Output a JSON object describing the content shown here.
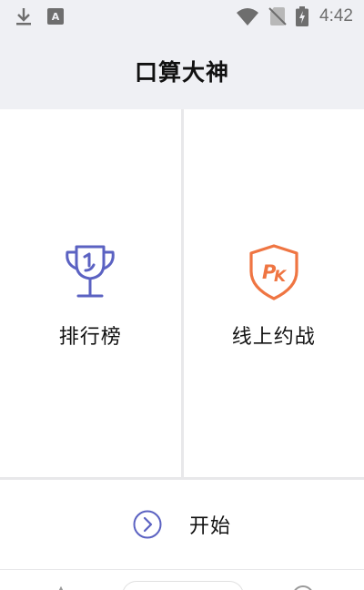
{
  "status_bar": {
    "time": "4:42",
    "icons": [
      "download-icon",
      "keyboard-a-icon",
      "wifi-icon",
      "no-sim-icon",
      "battery-charging-icon"
    ]
  },
  "header": {
    "title": "口算大神"
  },
  "panels": [
    {
      "label": "排行榜",
      "icon": "trophy-icon",
      "color": "#5b62c2"
    },
    {
      "label": "线上约战",
      "icon": "pk-shield-icon",
      "color": "#ef7542"
    }
  ],
  "start": {
    "label": "开始",
    "icon": "chevron-right-circle-icon",
    "color": "#5b62c2"
  },
  "colors": {
    "header_bg": "#eff0f4",
    "divider": "#e8e8ea"
  }
}
